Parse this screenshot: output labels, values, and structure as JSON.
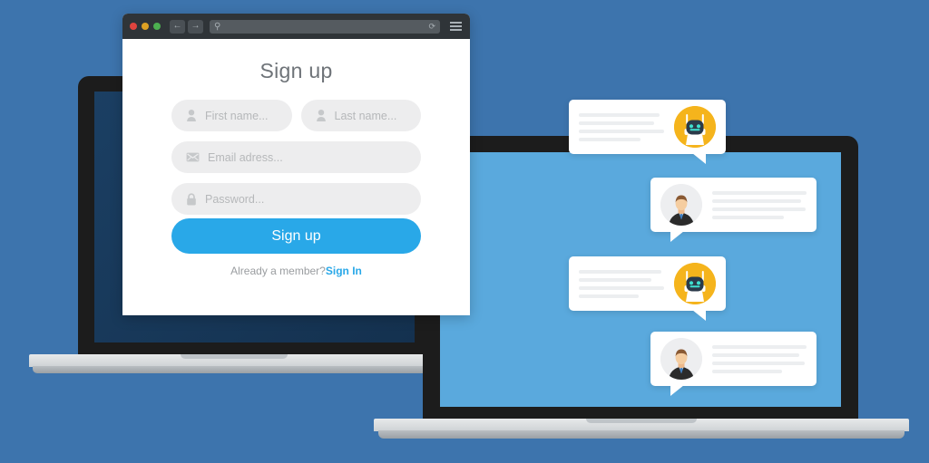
{
  "scene": {
    "background_color": "#3d74ad",
    "title": "Sign up form and chat app illustration"
  },
  "browser": {
    "traffic_lights": [
      "close-red",
      "minimize-yellow",
      "maximize-green"
    ],
    "back_icon": "←",
    "forward_icon": "→",
    "search_icon": "⚲",
    "reload_icon": "⟳",
    "menu_icon": "hamburger-icon",
    "address_value": ""
  },
  "signup": {
    "title": "Sign up",
    "fields": [
      {
        "name": "first-name",
        "placeholder": "First name...",
        "icon": "person-icon",
        "value": ""
      },
      {
        "name": "last-name",
        "placeholder": "Last name...",
        "icon": "person-icon",
        "value": ""
      },
      {
        "name": "email",
        "placeholder": "Email adress...",
        "icon": "envelope-icon",
        "value": ""
      },
      {
        "name": "password",
        "placeholder": "Password...",
        "icon": "lock-icon",
        "value": ""
      }
    ],
    "submit_label": "Sign up",
    "footer_text": "Already a member?",
    "signin_label": "Sign In",
    "accent_color": "#29a8e8",
    "field_bg_color": "#ededee"
  },
  "chat": {
    "screen_color": "#5aa9dd",
    "bot_avatar_color": "#f5b41c",
    "user_avatar_color": "#edeef0",
    "messages": [
      {
        "sender": "bot",
        "avatar": "robot-icon",
        "line_widths": [
          "95%",
          "88%",
          "100%",
          "72%"
        ]
      },
      {
        "sender": "user",
        "avatar": "person-avatar-icon",
        "line_widths": [
          "100%",
          "94%",
          "99%",
          "76%"
        ]
      },
      {
        "sender": "bot",
        "avatar": "robot-icon",
        "line_widths": [
          "97%",
          "85%",
          "100%",
          "70%"
        ]
      },
      {
        "sender": "user",
        "avatar": "person-avatar-icon",
        "line_widths": [
          "100%",
          "92%",
          "98%",
          "74%"
        ]
      }
    ]
  },
  "laptops": {
    "left": {
      "screen_color": "#1b3f63",
      "bezel_color": "#1c1c1c",
      "base_color": "#e7e9ea"
    },
    "right": {
      "screen_color": "#5aa9dd",
      "bezel_color": "#1c1c1c",
      "base_color": "#e7e9ea"
    }
  }
}
